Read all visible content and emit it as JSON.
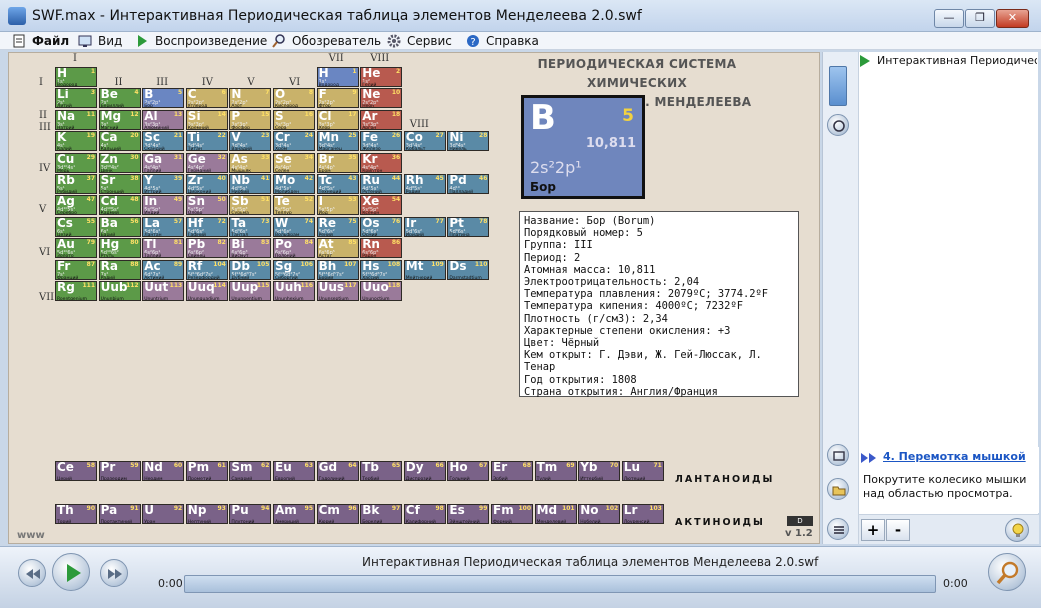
{
  "window": {
    "title": "SWF.max - Интерактивная Периодическая таблица элементов Менделеева 2.0.swf",
    "minimize": "—",
    "maximize": "❐",
    "close": "✕"
  },
  "menu": [
    {
      "label": "Файл",
      "icon": "file-icon"
    },
    {
      "label": "Вид",
      "icon": "view-icon"
    },
    {
      "label": "Воспроизведение",
      "icon": "play-icon"
    },
    {
      "label": "Обозреватель",
      "icon": "search-icon"
    },
    {
      "label": "Сервис",
      "icon": "gear-icon"
    },
    {
      "label": "Справка",
      "icon": "help-icon"
    }
  ],
  "table": {
    "heading_line1": "ПЕРИОДИЧЕСКАЯ СИСТЕМА ХИМИЧЕСКИХ",
    "heading_line2": "ЭЛЕМЕНТОВ Д. И. МЕНДЕЛЕЕВА",
    "group_labels": [
      "I",
      "II",
      "III",
      "IV",
      "V",
      "VI",
      "VII",
      "VIII",
      "VIII"
    ],
    "period_labels": [
      "I",
      "II",
      "III",
      "IV",
      "V",
      "VI",
      "VII"
    ],
    "lanthanides_label": "ЛАНТАНОИДЫ",
    "actinides_label": "АКТИНОИДЫ",
    "www": "www",
    "version": "v 1.2",
    "elements": [
      [
        "H",
        "1",
        "1s¹",
        "Водород"
      ],
      [
        "He",
        "2",
        "1s²",
        "Гелий"
      ],
      [
        "Li",
        "3",
        "2s¹",
        "Литий"
      ],
      [
        "Be",
        "4",
        "2s²",
        "Бериллий"
      ],
      [
        "B",
        "5",
        "2s²2p¹",
        "Бор"
      ],
      [
        "C",
        "6",
        "2s²2p²",
        "Углерод"
      ],
      [
        "N",
        "7",
        "2s²2p³",
        "Азот"
      ],
      [
        "O",
        "8",
        "2s²2p⁴",
        "Кислород"
      ],
      [
        "F",
        "9",
        "2s²2p⁵",
        "Фтор"
      ],
      [
        "Ne",
        "10",
        "2s²2p⁶",
        "Неон"
      ],
      [
        "Na",
        "11",
        "3s¹",
        "Натрий"
      ],
      [
        "Mg",
        "12",
        "3s²",
        "Магний"
      ],
      [
        "Al",
        "13",
        "3s²3p¹",
        "Алюминий"
      ],
      [
        "Si",
        "14",
        "3s²3p²",
        "Кремний"
      ],
      [
        "P",
        "15",
        "3s²3p³",
        "Фосфор"
      ],
      [
        "S",
        "16",
        "3s²3p⁴",
        "Сера"
      ],
      [
        "Cl",
        "17",
        "3s²3p⁵",
        "Хлор"
      ],
      [
        "Ar",
        "18",
        "3s²3p⁶",
        "Аргон"
      ],
      [
        "K",
        "19",
        "4s¹",
        "Калий"
      ],
      [
        "Ca",
        "20",
        "4s²",
        "Кальций"
      ],
      [
        "Sc",
        "21",
        "3d¹4s²",
        "Скандий"
      ],
      [
        "Ti",
        "22",
        "3d²4s²",
        "Титан"
      ],
      [
        "V",
        "23",
        "3d³4s²",
        "Ванадий"
      ],
      [
        "Cr",
        "24",
        "3d⁵4s¹",
        "Хром"
      ],
      [
        "Mn",
        "25",
        "3d⁵4s²",
        "Марганец"
      ],
      [
        "Fe",
        "26",
        "3d⁶4s²",
        "Железо"
      ],
      [
        "Co",
        "27",
        "3d⁷4s²",
        "Кобальт"
      ],
      [
        "Ni",
        "28",
        "3d⁸4s²",
        "Никель"
      ],
      [
        "Cu",
        "29",
        "3d¹⁰4s¹",
        "Медь"
      ],
      [
        "Zn",
        "30",
        "3d¹⁰4s²",
        "Цинк"
      ],
      [
        "Ga",
        "31",
        "4s²4p¹",
        "Галлий"
      ],
      [
        "Ge",
        "32",
        "4s²4p²",
        "Германий"
      ],
      [
        "As",
        "33",
        "4s²4p³",
        "Мышьяк"
      ],
      [
        "Se",
        "34",
        "4s²4p⁴",
        "Селен"
      ],
      [
        "Br",
        "35",
        "4s²4p⁵",
        "Бром"
      ],
      [
        "Kr",
        "36",
        "4s²4p⁶",
        "Криптон"
      ],
      [
        "Rb",
        "37",
        "5s¹",
        "Рубидий"
      ],
      [
        "Sr",
        "38",
        "5s²",
        "Стронций"
      ],
      [
        "Y",
        "39",
        "4d¹5s²",
        "Иттрий"
      ],
      [
        "Zr",
        "40",
        "4d²5s²",
        "Цирконий"
      ],
      [
        "Nb",
        "41",
        "4d⁴5s¹",
        "Ниобий"
      ],
      [
        "Mo",
        "42",
        "4d⁵5s¹",
        "Молибден"
      ],
      [
        "Tc",
        "43",
        "4d⁵5s²",
        "Технеций"
      ],
      [
        "Ru",
        "44",
        "4d⁷5s¹",
        "Рутений"
      ],
      [
        "Rh",
        "45",
        "4d⁸5s¹",
        "Родий"
      ],
      [
        "Pd",
        "46",
        "4d¹⁰",
        "Палладий"
      ],
      [
        "Ag",
        "47",
        "4d¹⁰5s¹",
        "Серебро"
      ],
      [
        "Cd",
        "48",
        "4d¹⁰5s²",
        "Кадмий"
      ],
      [
        "In",
        "49",
        "5s²5p¹",
        "Индий"
      ],
      [
        "Sn",
        "50",
        "5s²5p²",
        "Олово"
      ],
      [
        "Sb",
        "51",
        "5s²5p³",
        "Сурьма"
      ],
      [
        "Te",
        "52",
        "5s²5p⁴",
        "Теллур"
      ],
      [
        "I",
        "53",
        "5s²5p⁵",
        "Йод"
      ],
      [
        "Xe",
        "54",
        "5s²5p⁶",
        "Ксенон"
      ],
      [
        "Cs",
        "55",
        "6s¹",
        "Цезий"
      ],
      [
        "Ba",
        "56",
        "6s²",
        "Барий"
      ],
      [
        "La",
        "57",
        "5d¹6s²",
        "Лантан"
      ],
      [
        "Hf",
        "72",
        "5d²6s²",
        "Гафний"
      ],
      [
        "Ta",
        "73",
        "5d³6s²",
        "Тантал"
      ],
      [
        "W",
        "74",
        "5d⁴6s²",
        "Вольфрам"
      ],
      [
        "Re",
        "75",
        "5d⁵6s²",
        "Рений"
      ],
      [
        "Os",
        "76",
        "5d⁶6s²",
        "Осмий"
      ],
      [
        "Ir",
        "77",
        "5d⁷6s²",
        "Иридий"
      ],
      [
        "Pt",
        "78",
        "5d⁹6s¹",
        "Платина"
      ],
      [
        "Au",
        "79",
        "5d¹⁰6s¹",
        "Золото"
      ],
      [
        "Hg",
        "80",
        "5d¹⁰6s²",
        "Ртуть"
      ],
      [
        "Tl",
        "81",
        "6s²6p¹",
        "Таллий"
      ],
      [
        "Pb",
        "82",
        "6s²6p²",
        "Свинец"
      ],
      [
        "Bi",
        "83",
        "6s²6p³",
        "Висмут"
      ],
      [
        "Po",
        "84",
        "6s²6p⁴",
        "Полоний"
      ],
      [
        "At",
        "85",
        "6s²6p⁵",
        "Астат"
      ],
      [
        "Rn",
        "86",
        "6s²6p⁶",
        "Радон"
      ],
      [
        "Fr",
        "87",
        "7s¹",
        "Франций"
      ],
      [
        "Ra",
        "88",
        "7s²",
        "Радий"
      ],
      [
        "Ac",
        "89",
        "6d¹7s²",
        "Актиний"
      ],
      [
        "Rf",
        "104",
        "5f¹⁴6d²7s²",
        "Резерфордий"
      ],
      [
        "Db",
        "105",
        "5f¹⁴6d³7s²",
        "Дубний"
      ],
      [
        "Sg",
        "106",
        "5f¹⁴6d⁴7s²",
        "Сиборгий"
      ],
      [
        "Bh",
        "107",
        "5f¹⁴6d⁵7s²",
        "Борий"
      ],
      [
        "Hs",
        "108",
        "5f¹⁴6d⁶7s²",
        "Хассий"
      ],
      [
        "Mt",
        "109",
        "",
        "Мейтнерий"
      ],
      [
        "Ds",
        "110",
        "",
        "Darmstadtium"
      ],
      [
        "Rg",
        "111",
        "",
        "Roentgenium"
      ],
      [
        "Uub",
        "112",
        "",
        "Ununbium"
      ],
      [
        "Uut",
        "113",
        "",
        "Ununtrium"
      ],
      [
        "Uuq",
        "114",
        "",
        "Ununquadium"
      ],
      [
        "Uup",
        "115",
        "",
        "Ununpentium"
      ],
      [
        "Uuh",
        "116",
        "",
        "Ununhexium"
      ],
      [
        "Uus",
        "117",
        "",
        "Ununseptium"
      ],
      [
        "Uuo",
        "118",
        "",
        "Ununoctium"
      ]
    ],
    "lanthanides": [
      [
        "Ce",
        "58",
        "Церий"
      ],
      [
        "Pr",
        "59",
        "Празеодим"
      ],
      [
        "Nd",
        "60",
        "Неодим"
      ],
      [
        "Pm",
        "61",
        "Прометий"
      ],
      [
        "Sm",
        "62",
        "Самарий"
      ],
      [
        "Eu",
        "63",
        "Европий"
      ],
      [
        "Gd",
        "64",
        "Гадолиний"
      ],
      [
        "Tb",
        "65",
        "Тербий"
      ],
      [
        "Dy",
        "66",
        "Диспрозий"
      ],
      [
        "Ho",
        "67",
        "Гольмий"
      ],
      [
        "Er",
        "68",
        "Эрбий"
      ],
      [
        "Tm",
        "69",
        "Тулий"
      ],
      [
        "Yb",
        "70",
        "Иттербий"
      ],
      [
        "Lu",
        "71",
        "Лютеций"
      ]
    ],
    "actinides": [
      [
        "Th",
        "90",
        "Торий"
      ],
      [
        "Pa",
        "91",
        "Протактиний"
      ],
      [
        "U",
        "92",
        "Уран"
      ],
      [
        "Np",
        "93",
        "Нептуний"
      ],
      [
        "Pu",
        "94",
        "Плутоний"
      ],
      [
        "Am",
        "95",
        "Америций"
      ],
      [
        "Cm",
        "96",
        "Кюрий"
      ],
      [
        "Bk",
        "97",
        "Берклий"
      ],
      [
        "Cf",
        "98",
        "Калифорний"
      ],
      [
        "Es",
        "99",
        "Эйнштейний"
      ],
      [
        "Fm",
        "100",
        "Фермий"
      ],
      [
        "Md",
        "101",
        "Менделевий"
      ],
      [
        "No",
        "102",
        "Нобелий"
      ],
      [
        "Lr",
        "103",
        "Лоуренсий"
      ]
    ]
  },
  "selected": {
    "symbol": "B",
    "number": "5",
    "mass": "10,811",
    "config": "2s²2p¹",
    "name": "Бор"
  },
  "info": [
    "Название: Бор (Borum)",
    "Порядковый номер: 5",
    "Группа: III",
    "Период: 2",
    "Атомная масса: 10,811",
    "Электроотрицательность: 2,04",
    "Температура плавления: 2079ºC;  3774.2ºF",
    "Температура кипения: 4000ºC;  7232ºF",
    "Плотность (г/см3): 2,34",
    "Характерные степени окисления: +3",
    "Цвет: Чёрный",
    "Кем открыт: Г. Дэви, Ж. Гей-Люссак, Л. Тенар",
    "Год открытия: 1808",
    "Страна открытия: Англия/Франция"
  ],
  "playlist": {
    "item": "Интерактивная Периодическ"
  },
  "hint": {
    "title": "4. Перемотка мышкой",
    "text": "Покрутите колесико мышки над областью просмотра."
  },
  "zoom": {
    "plus": "+",
    "minus": "-"
  },
  "player": {
    "filename": "Интерактивная Периодическая таблица элементов Менделеева 2.0.swf",
    "time_start": "0:00",
    "time_end": "0:00"
  }
}
